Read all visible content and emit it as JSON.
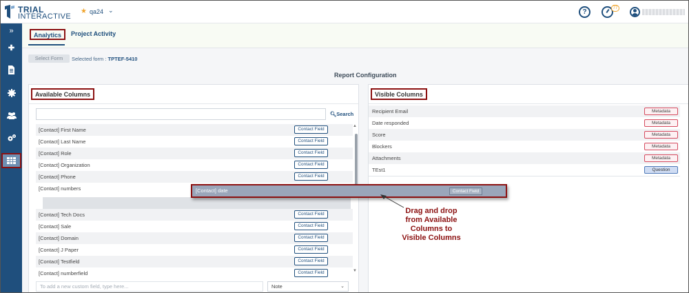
{
  "app": {
    "logo_line1": "TRIAL",
    "logo_line2": "INTERACTIVE",
    "study_name": "qa24",
    "timer_badge": "77",
    "colors": {
      "brand": "#1f4f7d",
      "accent": "#f0a42b",
      "highlight": "#8b1010"
    }
  },
  "sidebar": {
    "items": [
      {
        "icon": "expand-icon",
        "glyph": "»"
      },
      {
        "icon": "plus-icon",
        "glyph": "✚"
      },
      {
        "icon": "document-icon",
        "glyph": "▤"
      },
      {
        "icon": "badge-icon",
        "glyph": "✹"
      },
      {
        "icon": "users-icon",
        "glyph": "👥"
      },
      {
        "icon": "settings-icon",
        "glyph": "⚙"
      },
      {
        "icon": "table-icon",
        "glyph": "▦",
        "active": true
      }
    ]
  },
  "tabs": [
    {
      "label": "Analytics",
      "active": true
    },
    {
      "label": "Project Activity",
      "active": false
    }
  ],
  "form": {
    "select_button": "Select Form",
    "selected_label": "Selected form :",
    "selected_value": "TPTEF-5410"
  },
  "report_title": "Report Configuration",
  "available": {
    "title": "Available Columns",
    "search_button": "Search",
    "rows": [
      {
        "label": "[Contact] First Name",
        "tag": "Contact Field"
      },
      {
        "label": "[Contact] Last Name",
        "tag": "Contact Field"
      },
      {
        "label": "[Contact] Role",
        "tag": "Contact Field"
      },
      {
        "label": "[Contact] Organization",
        "tag": "Contact Field"
      },
      {
        "label": "[Contact] Phone",
        "tag": "Contact Field"
      },
      {
        "label": "[Contact] numbers",
        "tag": ""
      },
      {
        "label": "[Contact] Tech Docs",
        "tag": "Contact Field"
      },
      {
        "label": "[Contact] Sale",
        "tag": "Contact Field"
      },
      {
        "label": "[Contact] Domain",
        "tag": "Contact Field"
      },
      {
        "label": "[Contact] J Paper",
        "tag": "Contact Field"
      },
      {
        "label": "[Contact] Testfield",
        "tag": "Contact Field"
      },
      {
        "label": "[Contact] numberfield",
        "tag": "Contact Field"
      }
    ],
    "custom_field_placeholder": "To add a new custom field, type here...",
    "field_type": "Note"
  },
  "visible": {
    "title": "Visible Columns",
    "rows": [
      {
        "label": "Recipient Email",
        "tag": "Metadata"
      },
      {
        "label": "Date responded",
        "tag": "Metadata"
      },
      {
        "label": "Score",
        "tag": "Metadata"
      },
      {
        "label": "Blockers",
        "tag": "Metadata"
      },
      {
        "label": "Attachments",
        "tag": "Metadata"
      },
      {
        "label": "TEst1",
        "tag": "Question"
      }
    ]
  },
  "drag": {
    "label": "[Contact] date",
    "tag": "Contact Field"
  },
  "callout": {
    "line1": "Drag and drop",
    "line2": "from Available",
    "line3": "Columns to",
    "line4": "Visible Columns"
  }
}
